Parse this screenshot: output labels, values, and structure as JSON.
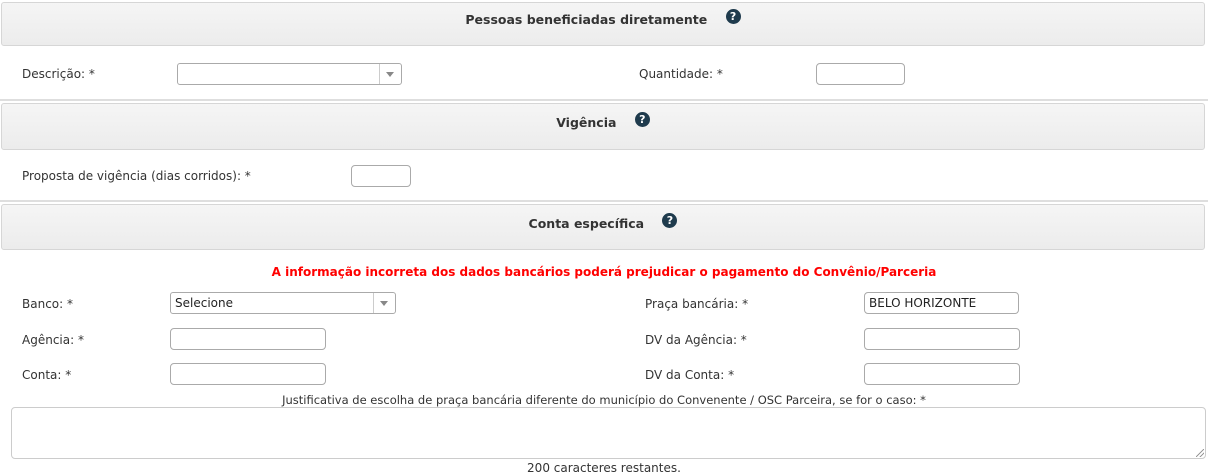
{
  "sections": {
    "beneficiaries": {
      "title": "Pessoas beneficiadas diretamente",
      "help_icon": "question-circle-icon",
      "description_label": "Descrição: *",
      "description_value": "",
      "quantity_label": "Quantidade: *",
      "quantity_value": ""
    },
    "validity": {
      "title": "Vigência",
      "help_icon": "question-circle-icon",
      "proposal_label": "Proposta de vigência (dias corridos): *",
      "proposal_value": ""
    },
    "account": {
      "title": "Conta específica",
      "help_icon": "question-circle-icon",
      "warning": "A informação incorreta dos dados bancários poderá prejudicar o pagamento do Convênio/Parceria",
      "bank_label": "Banco: *",
      "bank_selected": "Selecione",
      "bank_square_label": "Praça bancária: *",
      "bank_square_value": "BELO HORIZONTE",
      "agency_label": "Agência: *",
      "agency_value": "",
      "agency_dv_label": "DV da Agência: *",
      "agency_dv_value": "",
      "account_label": "Conta: *",
      "account_value": "",
      "account_dv_label": "DV da Conta: *",
      "account_dv_value": "",
      "justification_label": "Justificativa de escolha de praça bancária diferente do município do Convenente / OSC Parceira, se for o caso: *",
      "justification_value": "",
      "chars_remaining": "200 caracteres restantes."
    }
  },
  "colors": {
    "header_bg": "#ececec",
    "warning": "#ff0000",
    "help_icon": "#1f3b4d"
  }
}
